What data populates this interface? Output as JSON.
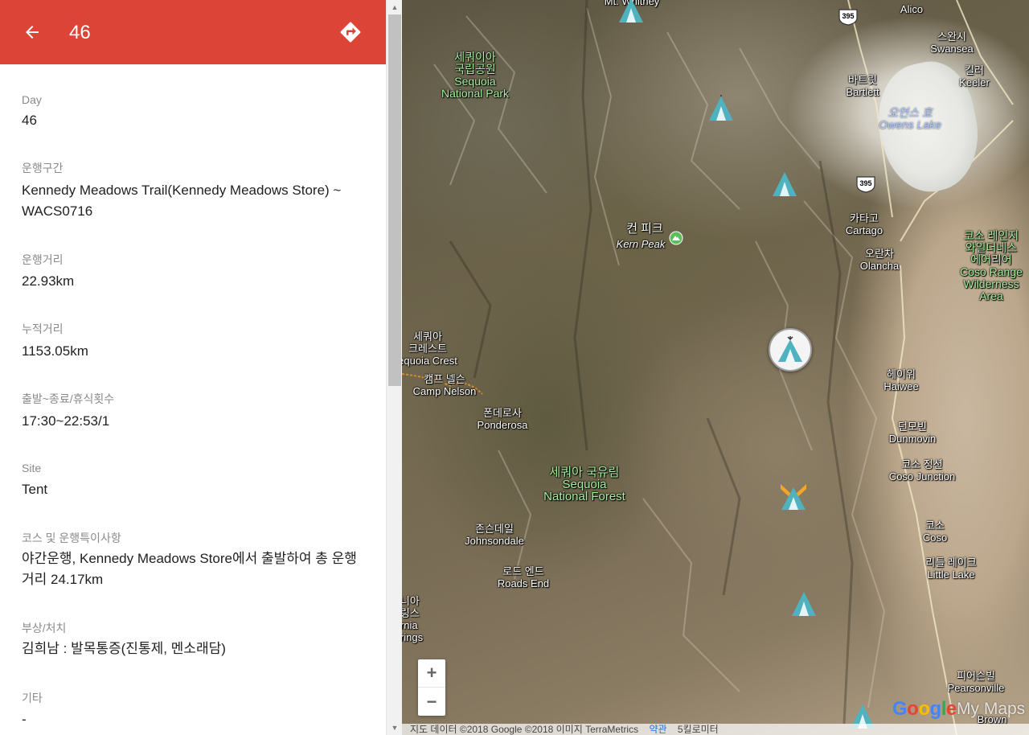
{
  "header": {
    "title": "46",
    "back_icon": "arrow-left-icon",
    "directions_icon": "directions-icon",
    "color": "#db4437"
  },
  "fields": [
    {
      "label": "Day",
      "value": "46"
    },
    {
      "label": "운행구간",
      "value": "Kennedy Meadows Trail(Kennedy Meadows Store) ~ WACS0716"
    },
    {
      "label": "운행거리",
      "value": "22.93km"
    },
    {
      "label": "누적거리",
      "value": "1153.05km"
    },
    {
      "label": "출발~종료/휴식횟수",
      "value": "17:30~22:53/1"
    },
    {
      "label": "Site",
      "value": "Tent"
    },
    {
      "label": "코스 및 운행특이사항",
      "value": "야간운행, Kennedy Meadows Store에서 출발하여 총 운행거리 24.17km"
    },
    {
      "label": "부상/처치",
      "value": "김희남 : 발목통증(진통제, 멘소래담)"
    },
    {
      "label": "기타",
      "value": "-"
    }
  ],
  "map": {
    "labels": {
      "mt_whitney": "Mt. Whitney",
      "alico": "Alico",
      "swansea_ko": "스완시",
      "swansea": "Swansea",
      "keeler_ko": "킬러",
      "keeler": "Keeler",
      "sequoia_np_ko_1": "세쿼이아",
      "sequoia_np_ko_2": "국립공원",
      "sequoia_np_1": "Sequoia",
      "sequoia_np_2": "National Park",
      "bartlett_ko": "바트릿",
      "bartlett": "Bartlett",
      "owens_lake_ko": "오언스 호",
      "owens_lake": "Owens Lake",
      "kern_peak_ko": "컨 피크",
      "kern_peak": "Kern Peak",
      "cartago_ko": "카타고",
      "cartago": "Cartago",
      "olancha_ko": "오란차",
      "olancha": "Olancha",
      "coso_wild_ko_1": "코소 레인지",
      "coso_wild_ko_2": "와일더네스",
      "coso_wild_ko_3": "에어리어",
      "coso_wild_1": "Coso Range",
      "coso_wild_2": "Wilderness",
      "coso_wild_3": "Area",
      "sequoia_crest_ko_1": "세쿼아",
      "sequoia_crest_ko_2": "크레스트",
      "sequoia_crest": "equoia Crest",
      "camp_nelson_ko": "캠프 넬슨",
      "camp_nelson": "Camp Nelson",
      "haiwee_ko": "헤이위",
      "haiwee": "Haiwee",
      "ponderosa_ko": "폰데로사",
      "ponderosa": "Ponderosa",
      "dunmovin_ko": "던모빈",
      "dunmovin": "Dunmovin",
      "coso_junction_ko": "코소 정션",
      "coso_junction": "Coso Junction",
      "sequoia_nf_ko": "세쿼아 국유림",
      "sequoia_nf_1": "Sequoia",
      "sequoia_nf_2": "National Forest",
      "johnsondale_ko": "존슨데일",
      "johnsondale": "Johnsondale",
      "coso_ko": "코소",
      "coso": "Coso",
      "roads_end_ko": "로드 엔드",
      "roads_end": "Roads End",
      "little_lake_ko": "리틀 레이크",
      "little_lake": "Little Lake",
      "california_hot_springs_1": "니아",
      "california_hot_springs_2": "링스",
      "california_hot_springs_3": "rnia",
      "california_hot_springs_4": "rings",
      "pearsonville_ko": "피어슨빌",
      "pearsonville": "Pearsonville",
      "brown": "Brown"
    },
    "highway_395": "395",
    "marker_icon": "tent-icon",
    "marker_color": "#4fb3bf",
    "zoom_in": "+",
    "zoom_out": "−",
    "google_logo": "Google",
    "mymaps": "My Maps",
    "attribution": "지도 데이터 ©2018 Google ©2018 이미지 TerraMetrics",
    "terms": "약관",
    "scale": "5킬로미터"
  }
}
